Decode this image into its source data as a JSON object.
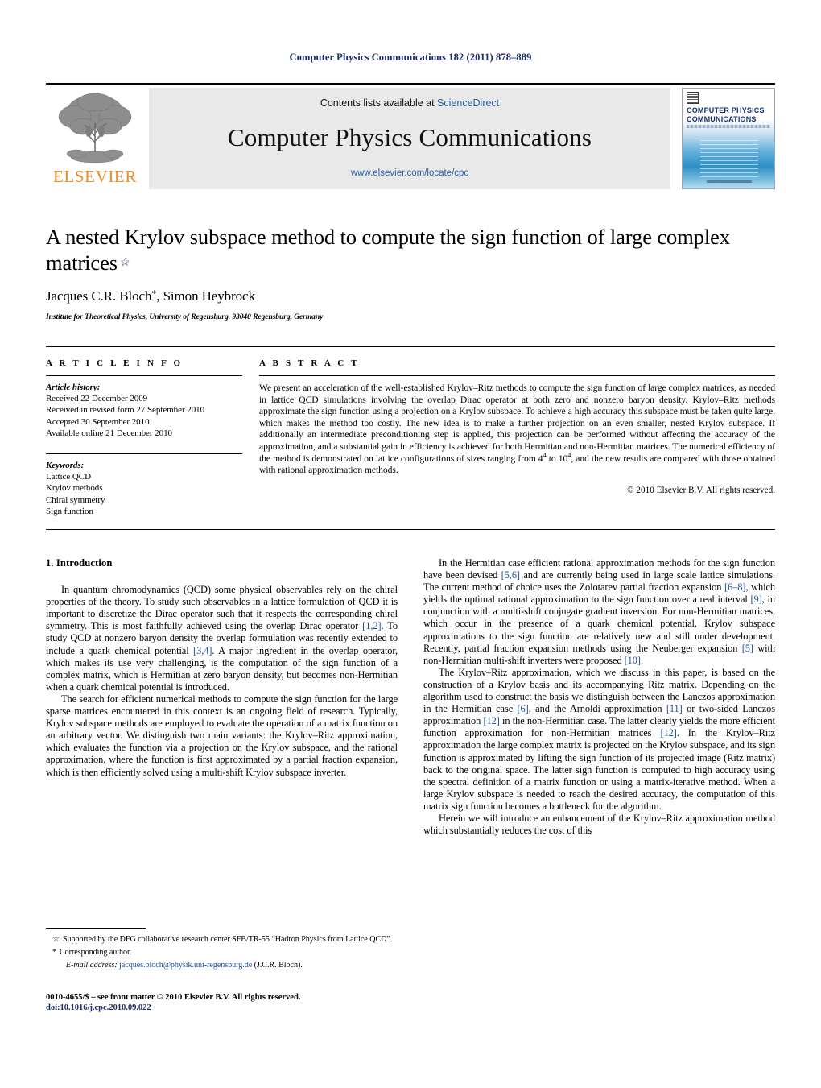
{
  "running_head": "Computer Physics Communications 182 (2011) 878–889",
  "masthead": {
    "publisher_name": "ELSEVIER",
    "contents_prefix": "Contents lists available at ",
    "contents_link": "ScienceDirect",
    "journal_title": "Computer Physics Communications",
    "journal_url": "www.elsevier.com/locate/cpc",
    "cover_title": "COMPUTER PHYSICS COMMUNICATIONS"
  },
  "article": {
    "title": "A nested Krylov subspace method to compute the sign function of large complex matrices",
    "title_footnote_mark": "☆",
    "authors": "Jacques C.R. Bloch",
    "authors_mark": "*",
    "authors_rest": ", Simon Heybrock",
    "affiliation": "Institute for Theoretical Physics, University of Regensburg, 93040 Regensburg, Germany"
  },
  "info": {
    "heading": "A R T I C L E   I N F O",
    "history_label": "Article history:",
    "history": [
      "Received 22 December 2009",
      "Received in revised form 27 September 2010",
      "Accepted 30 September 2010",
      "Available online 21 December 2010"
    ],
    "keywords_label": "Keywords:",
    "keywords": [
      "Lattice QCD",
      "Krylov methods",
      "Chiral symmetry",
      "Sign function"
    ]
  },
  "abstract": {
    "heading": "A B S T R A C T",
    "text_part1": "We present an acceleration of the well-established Krylov–Ritz methods to compute the sign function of large complex matrices, as needed in lattice QCD simulations involving the overlap Dirac operator at both zero and nonzero baryon density. Krylov–Ritz methods approximate the sign function using a projection on a Krylov subspace. To achieve a high accuracy this subspace must be taken quite large, which makes the method too costly. The new idea is to make a further projection on an even smaller, nested Krylov subspace. If additionally an intermediate preconditioning step is applied, this projection can be performed without affecting the accuracy of the approximation, and a substantial gain in efficiency is achieved for both Hermitian and non-Hermitian matrices. The numerical efficiency of the method is demonstrated on lattice configurations of sizes ranging from 4",
    "exp1": "4",
    "text_part2": " to 10",
    "exp2": "4",
    "text_part3": ", and the new results are compared with those obtained with rational approximation methods.",
    "copyright": "© 2010 Elsevier B.V. All rights reserved."
  },
  "body": {
    "section_heading": "1. Introduction",
    "left_p1_a": "In quantum chromodynamics (QCD) some physical observables rely on the chiral properties of the theory. To study such observables in a lattice formulation of QCD it is important to discretize the Dirac operator such that it respects the corresponding chiral symmetry. This is most faithfully achieved using the overlap Dirac operator ",
    "left_p1_ref1": "[1,2]",
    "left_p1_b": ". To study QCD at nonzero baryon density the overlap formulation was recently extended to include a quark chemical potential ",
    "left_p1_ref2": "[3,4]",
    "left_p1_c": ". A major ingredient in the overlap operator, which makes its use very challenging, is the computation of the sign function of a complex matrix, which is Hermitian at zero baryon density, but becomes non-Hermitian when a quark chemical potential is introduced.",
    "left_p2": "The search for efficient numerical methods to compute the sign function for the large sparse matrices encountered in this context is an ongoing field of research. Typically, Krylov subspace methods are employed to evaluate the operation of a matrix function on an arbitrary vector. We distinguish two main variants: the Krylov–Ritz approximation, which evaluates the function via a projection on the Krylov subspace, and the rational approximation, where the function is first approximated by a partial fraction expansion, which is then efficiently solved using a multi-shift Krylov subspace inverter.",
    "right_p1_a": "In the Hermitian case efficient rational approximation methods for the sign function have been devised ",
    "right_p1_ref1": "[5,6]",
    "right_p1_b": " and are currently being used in large scale lattice simulations. The current method of choice uses the Zolotarev partial fraction expansion ",
    "right_p1_ref2": "[6–8]",
    "right_p1_c": ", which yields the optimal rational approximation to the sign function over a real interval ",
    "right_p1_ref3": "[9]",
    "right_p1_d": ", in conjunction with a multi-shift conjugate gradient inversion. For non-Hermitian matrices, which occur in the presence of a quark chemical potential, Krylov subspace approximations to the sign function are relatively new and still under development. Recently, partial fraction expansion methods using the Neuberger expansion ",
    "right_p1_ref4": "[5]",
    "right_p1_e": " with non-Hermitian multi-shift inverters were proposed ",
    "right_p1_ref5": "[10]",
    "right_p1_f": ".",
    "right_p2_a": "The Krylov–Ritz approximation, which we discuss in this paper, is based on the construction of a Krylov basis and its accompanying Ritz matrix. Depending on the algorithm used to construct the basis we distinguish between the Lanczos approximation in the Hermitian case ",
    "right_p2_ref1": "[6]",
    "right_p2_b": ", and the Arnoldi approximation ",
    "right_p2_ref2": "[11]",
    "right_p2_c": " or two-sided Lanczos approximation ",
    "right_p2_ref3": "[12]",
    "right_p2_d": " in the non-Hermitian case. The latter clearly yields the more efficient function approximation for non-Hermitian matrices ",
    "right_p2_ref4": "[12]",
    "right_p2_e": ". In the Krylov–Ritz approximation the large complex matrix is projected on the Krylov subspace, and its sign function is approximated by lifting the sign function of its projected image (Ritz matrix) back to the original space. The latter sign function is computed to high accuracy using the spectral definition of a matrix function or using a matrix-iterative method. When a large Krylov subspace is needed to reach the desired accuracy, the computation of this matrix sign function becomes a bottleneck for the algorithm.",
    "right_p3": "Herein we will introduce an enhancement of the Krylov–Ritz approximation method which substantially reduces the cost of this"
  },
  "footnotes": {
    "star_mark": "☆",
    "star_text": "Supported by the DFG collaborative research center SFB/TR-55 “Hadron Physics from Lattice QCD”.",
    "corresp_mark": "*",
    "corresp_text": "Corresponding author.",
    "email_label": "E-mail address:",
    "email": "jacques.bloch@physik.uni-regensburg.de",
    "email_suffix": "(J.C.R. Bloch)."
  },
  "imprint": {
    "line1": "0010-4655/$ – see front matter © 2010 Elsevier B.V. All rights reserved.",
    "doi": "doi:10.1016/j.cpc.2010.09.022"
  },
  "colors": {
    "header_blue": "#1b2d6b",
    "link_blue": "#1b4f9c",
    "sciencedirect_blue": "#2a5fa5",
    "elsevier_orange": "#f08a22",
    "band_gray": "#e9e9e9"
  }
}
